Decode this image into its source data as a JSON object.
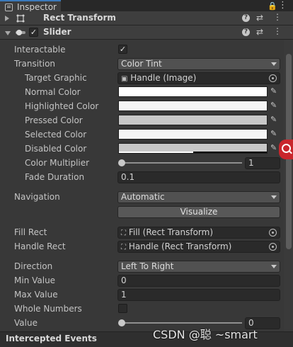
{
  "tab": {
    "title": "Inspector",
    "icon": "inspector-icon"
  },
  "header_icons": {
    "lock": "🔒",
    "menu": "⋮"
  },
  "rect_transform": {
    "title": "Rect Transform",
    "icon": "rect-transform-icon"
  },
  "slider_component": {
    "title": "Slider",
    "icon": "slider-component-icon",
    "enabled": true
  },
  "fields": {
    "interactable": {
      "label": "Interactable",
      "checked": true
    },
    "transition": {
      "label": "Transition",
      "value": "Color Tint"
    },
    "target_graphic": {
      "label": "Target Graphic",
      "value": "Handle (Image)"
    },
    "normal_color": {
      "label": "Normal Color",
      "color": "#ffffff"
    },
    "highlighted_color": {
      "label": "Highlighted Color",
      "color": "#f5f5f5"
    },
    "pressed_color": {
      "label": "Pressed Color",
      "color": "#c8c8c8"
    },
    "selected_color": {
      "label": "Selected Color",
      "color": "#f5f5f5"
    },
    "disabled_color": {
      "label": "Disabled Color",
      "color": "#c8c8c8"
    },
    "color_multiplier": {
      "label": "Color Multiplier",
      "value": "1",
      "level": 0
    },
    "fade_duration": {
      "label": "Fade Duration",
      "value": "0.1"
    },
    "navigation": {
      "label": "Navigation",
      "value": "Automatic"
    },
    "visualize": {
      "label": "Visualize"
    },
    "fill_rect": {
      "label": "Fill Rect",
      "value": "Fill (Rect Transform)"
    },
    "handle_rect": {
      "label": "Handle Rect",
      "value": "Handle (Rect Transform)"
    },
    "direction": {
      "label": "Direction",
      "value": "Left To Right"
    },
    "min_value": {
      "label": "Min Value",
      "value": "0"
    },
    "max_value": {
      "label": "Max Value",
      "value": "1"
    },
    "whole_numbers": {
      "label": "Whole Numbers",
      "checked": false
    },
    "value": {
      "label": "Value",
      "value": "0",
      "level": 0
    }
  },
  "intercepted_events": {
    "title": "Intercepted Events"
  },
  "watermark": {
    "text": "CSDN @聪       ~smart"
  },
  "colors": {
    "accent": "#3a79bb",
    "background": "#383838",
    "float_button": "#c9262c"
  }
}
